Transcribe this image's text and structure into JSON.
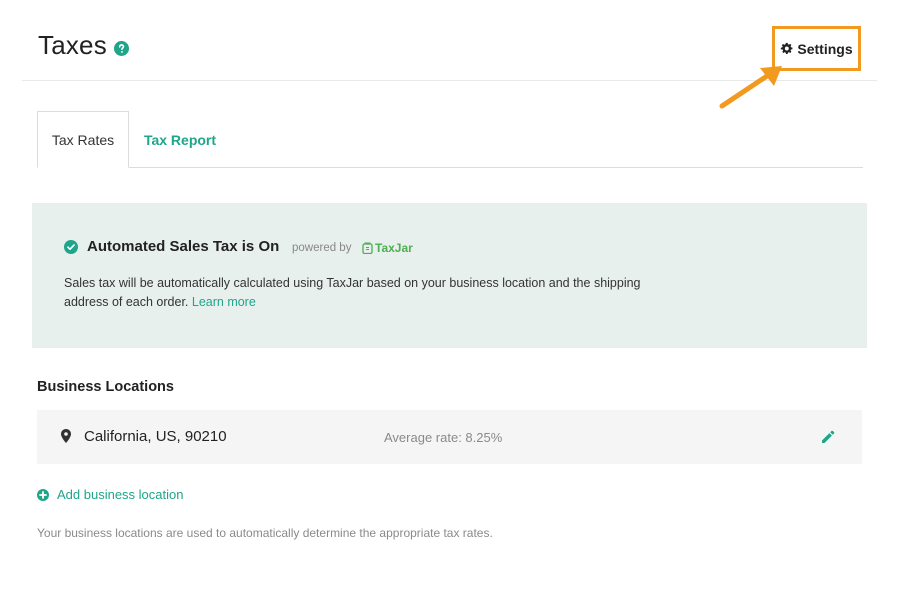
{
  "header": {
    "title": "Taxes",
    "help_icon": "question-circle-icon",
    "settings_label": "Settings",
    "settings_icon": "gear-icon"
  },
  "tabs": [
    {
      "label": "Tax Rates",
      "active": true
    },
    {
      "label": "Tax Report",
      "active": false
    }
  ],
  "banner": {
    "title": "Automated Sales Tax is On",
    "powered_by": "powered by",
    "provider": "TaxJar",
    "description": "Sales tax will be automatically calculated using TaxJar based on your business location and the shipping address of each order.",
    "learn_more": "Learn more"
  },
  "locations": {
    "title": "Business Locations",
    "items": [
      {
        "name": "California, US, 90210",
        "rate": "Average rate: 8.25%"
      }
    ],
    "add_label": "Add business location",
    "footnote": "Your business locations are used to automatically determine the appropriate tax rates."
  },
  "colors": {
    "accent": "#1fa58a",
    "highlight": "#f29a1f",
    "banner_bg": "#e8f0ed"
  }
}
